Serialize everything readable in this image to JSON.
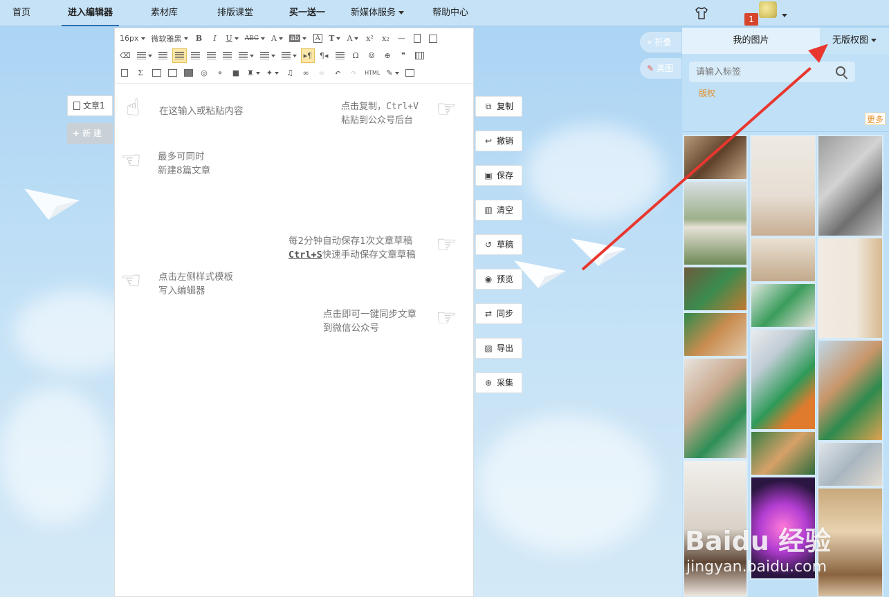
{
  "nav": {
    "items": [
      "首页",
      "进入编辑器",
      "素材库",
      "排版课堂",
      "买一送一",
      "新媒体服务",
      "帮助中心"
    ],
    "active": "进入编辑器",
    "notification_count": "1"
  },
  "articles": {
    "tab_label": "文章1",
    "new_label": "新 建"
  },
  "toolbar": {
    "font_size": "16px",
    "font_family": "微软雅黑",
    "html_label": "HTML"
  },
  "hints": {
    "input_paste": "在这输入或粘贴内容",
    "copy_paste": "点击复制，Ctrl+V\n粘贴到公众号后台",
    "max_articles": "最多可同时\n新建8篇文章",
    "autosave": "每2分钟自动保存1次文章草稿",
    "autosave_shortcut": "Ctrl+S",
    "autosave_suffix": "快速手动保存文章草稿",
    "template_hint": "点击左侧样式模板\n写入编辑器",
    "sync_hint": "点击即可一键同步文章\n到微信公众号"
  },
  "actions": {
    "copy": "复制",
    "undo": "撤销",
    "save": "保存",
    "clear": "清空",
    "draft": "草稿",
    "preview": "预览",
    "sync": "同步",
    "export": "导出",
    "collect": "采集"
  },
  "side_buttons": {
    "fold": "折叠",
    "meitu": "美图"
  },
  "panel": {
    "tab_mine": "我的图片",
    "tab_free": "无版权图",
    "search_placeholder": "请输入标签",
    "tag": "版权",
    "more": "更多"
  },
  "watermark": {
    "brand": "Baidu 经验",
    "url": "jingyan.baidu.com"
  },
  "colors": {
    "arrow": "#e8372f",
    "accent_orange": "#e6902a",
    "nav_bg": "#c6e2f7"
  }
}
